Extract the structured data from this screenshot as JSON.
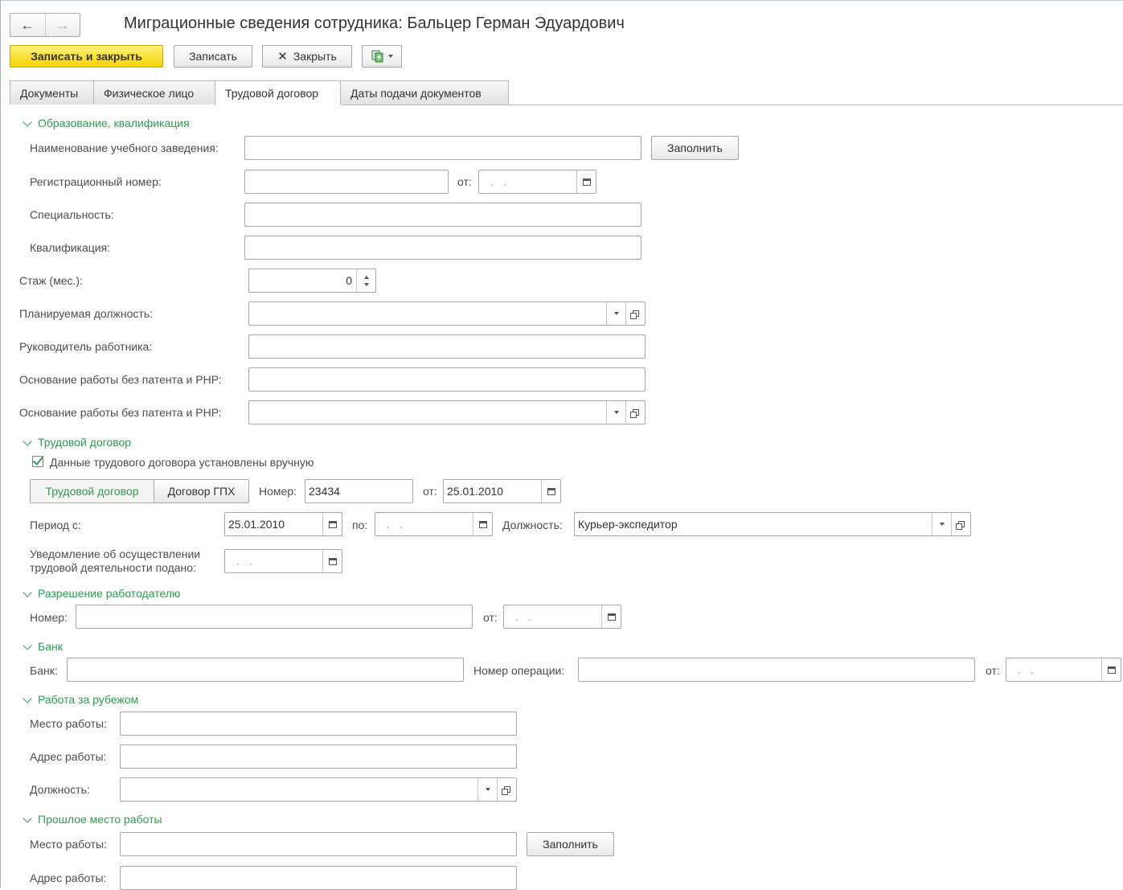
{
  "window": {
    "title": "Миграционные сведения сотрудника: Бальцер Герман Эдуардович",
    "nav_back": "←",
    "nav_forward": "→"
  },
  "toolbar": {
    "save_close": "Записать и закрыть",
    "save": "Записать",
    "close": "Закрыть",
    "close_icon": "✕"
  },
  "tabs": [
    {
      "label": "Документы"
    },
    {
      "label": "Физическое лицо"
    },
    {
      "label": "Трудовой договор"
    },
    {
      "label": "Даты подачи документов"
    }
  ],
  "education": {
    "header": "Образование, квалификация",
    "institution_label": "Наименование учебного заведения:",
    "fill_button": "Заполнить",
    "regnum_label": "Регистрационный номер:",
    "from_label": "от:",
    "specialty_label": "Специальность:",
    "qualification_label": "Квалификация:",
    "empty_date": ". ."
  },
  "work": {
    "experience_label": "Стаж (мес.):",
    "experience_value": "0",
    "planned_position_label": "Планируемая должность:",
    "manager_label": "Руководитель работника:",
    "basis1_label": "Основание работы без патента и РНР:",
    "basis2_label": "Основание работы без патента и РНР:"
  },
  "contract": {
    "header": "Трудовой договор",
    "manual_checkbox": "Данные трудового договора установлены вручную",
    "seg_labor": "Трудовой договор",
    "seg_gph": "Договор ГПХ",
    "number_label": "Номер:",
    "number_value": "23434",
    "from_label": "от:",
    "from_value": "25.01.2010",
    "period_label": "Период с:",
    "period_from": "25.01.2010",
    "to_label": "по:",
    "position_label": "Должность:",
    "position_value": "Курьер-экспедитор",
    "notice_label_1": "Уведомление об осуществлении",
    "notice_label_2": "трудовой деятельности подано:"
  },
  "permit": {
    "header": "Разрешение работодателю",
    "number_label": "Номер:",
    "from_label": "от:"
  },
  "bank": {
    "header": "Банк",
    "bank_label": "Банк:",
    "operation_label": "Номер операции:",
    "from_label": "от:"
  },
  "abroad": {
    "header": "Работа за рубежом",
    "place_label": "Место работы:",
    "address_label": "Адрес работы:",
    "position_label": "Должность:"
  },
  "past": {
    "header": "Прошлое место работы",
    "place_label": "Место работы:",
    "fill_button": "Заполнить",
    "address_label": "Адрес работы:"
  }
}
